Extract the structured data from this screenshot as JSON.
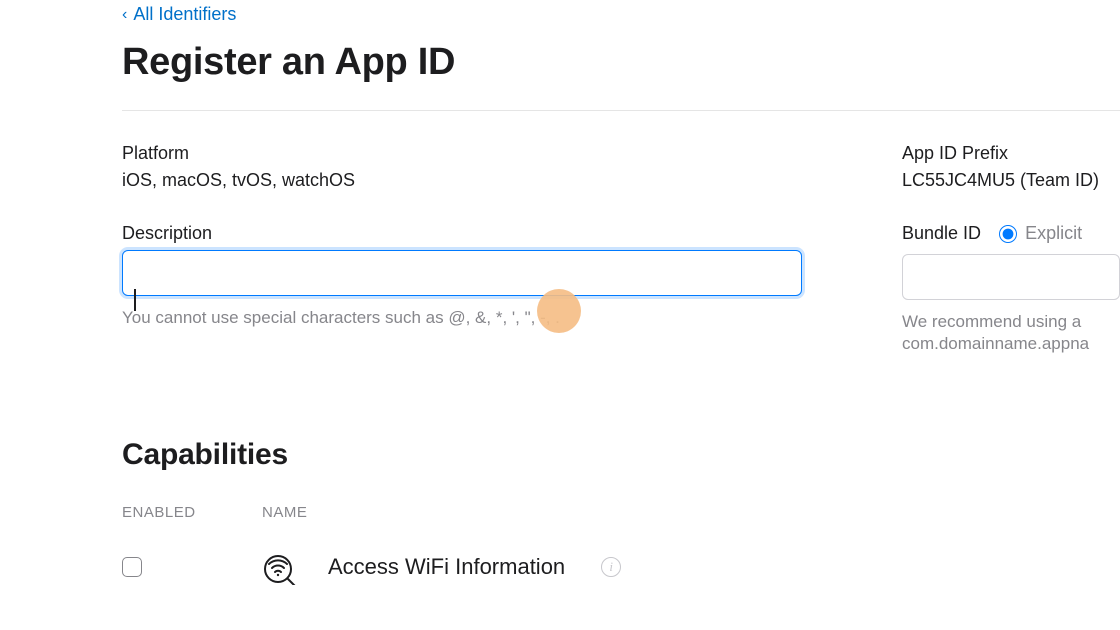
{
  "back_link": "All Identifiers",
  "page_title": "Register an App ID",
  "left": {
    "platform_label": "Platform",
    "platform_value": "iOS, macOS, tvOS, watchOS",
    "description_label": "Description",
    "description_value": "",
    "description_help": "You cannot use special characters such as @, &, *, ', \", -, ."
  },
  "right": {
    "prefix_label": "App ID Prefix",
    "prefix_value": "LC55JC4MU5 (Team ID)",
    "bundle_label": "Bundle ID",
    "bundle_option_explicit": "Explicit",
    "bundle_help1": "We recommend using a",
    "bundle_help2": "com.domainname.appna"
  },
  "capabilities": {
    "title": "Capabilities",
    "header_enabled": "ENABLED",
    "header_name": "NAME",
    "rows": [
      {
        "name": "Access WiFi Information",
        "icon": "wifi-search-icon"
      }
    ]
  }
}
